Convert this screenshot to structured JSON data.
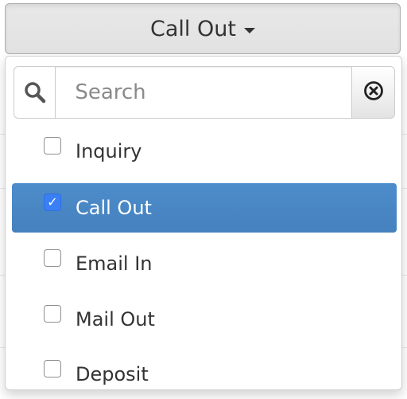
{
  "dropdown": {
    "selected_label": "Call Out",
    "caret_icon": "caret-down-icon"
  },
  "search": {
    "placeholder": "Search",
    "value": "",
    "search_icon": "search-icon",
    "clear_icon": "clear-circle-icon"
  },
  "options": [
    {
      "label": "Inquiry",
      "checked": false
    },
    {
      "label": "Call Out",
      "checked": true
    },
    {
      "label": "Email In",
      "checked": false
    },
    {
      "label": "Mail Out",
      "checked": false
    },
    {
      "label": "Deposit",
      "checked": false
    }
  ],
  "colors": {
    "selected_bg": "#4b88c4",
    "checkbox_checked": "#3b7ff5"
  }
}
